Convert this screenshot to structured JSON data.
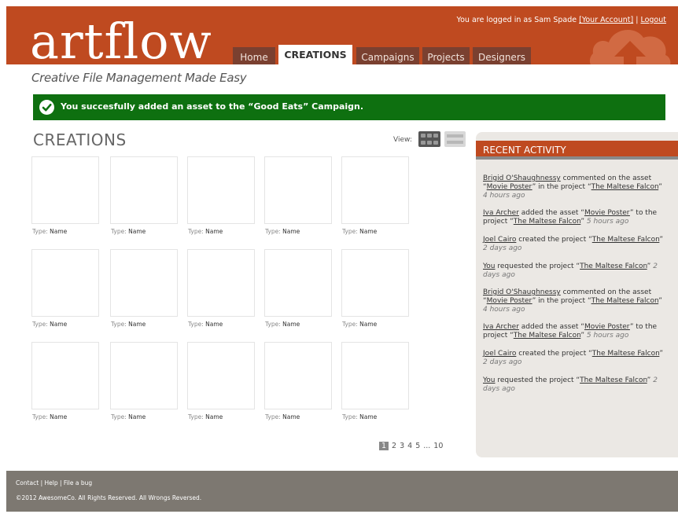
{
  "header": {
    "logo": "artflow",
    "user_prefix": "You are logged in as Sam Spade",
    "account_link": "[Your Account]",
    "separator": "|",
    "logout": "Logout",
    "tagline": "Creative File Management Made Easy"
  },
  "nav": {
    "tabs": [
      {
        "label": "Home"
      },
      {
        "label": "CREATIONS"
      },
      {
        "label": "Campaigns"
      },
      {
        "label": "Projects"
      },
      {
        "label": "Designers"
      }
    ]
  },
  "alert": {
    "message": "You succesfully added an asset to the “Good Eats” Campaign."
  },
  "main": {
    "title": "CREATIONS",
    "view_label": "View:",
    "items": [
      {
        "type_label": "Type:",
        "name": "Name"
      },
      {
        "type_label": "Type:",
        "name": "Name"
      },
      {
        "type_label": "Type:",
        "name": "Name"
      },
      {
        "type_label": "Type:",
        "name": "Name"
      },
      {
        "type_label": "Type:",
        "name": "Name"
      },
      {
        "type_label": "Type:",
        "name": "Name"
      },
      {
        "type_label": "Type:",
        "name": "Name"
      },
      {
        "type_label": "Type:",
        "name": "Name"
      },
      {
        "type_label": "Type:",
        "name": "Name"
      },
      {
        "type_label": "Type:",
        "name": "Name"
      },
      {
        "type_label": "Type:",
        "name": "Name"
      },
      {
        "type_label": "Type:",
        "name": "Name"
      },
      {
        "type_label": "Type:",
        "name": "Name"
      },
      {
        "type_label": "Type:",
        "name": "Name"
      },
      {
        "type_label": "Type:",
        "name": "Name"
      }
    ],
    "pagination": {
      "current": "1",
      "pages": [
        "2",
        "3",
        "4",
        "5"
      ],
      "ellipsis": "...",
      "last": "10"
    }
  },
  "activity": {
    "title": "RECENT ACTIVITY",
    "items": [
      {
        "user": "Brigid O'Shaughnessy",
        "text1": " commented on the asset “",
        "asset": "Movie Poster",
        "text2": "” in the project “",
        "project": "The Maltese Falcon",
        "text3": "”",
        "time": "4 hours ago"
      },
      {
        "user": "Iva Archer",
        "text1": " added the asset “",
        "asset": "Movie Poster",
        "text2": "” to the project “",
        "project": "The Maltese Falcon",
        "text3": "”",
        "time": "5 hours ago"
      },
      {
        "user": "Joel Cairo",
        "text1": " created the project “",
        "project": "The Maltese Falcon",
        "text3": "”",
        "time": "2 days ago"
      },
      {
        "user": "You",
        "text1": " requested the project “",
        "project": "The Maltese Falcon",
        "text3": "”",
        "time": "2 days ago"
      },
      {
        "user": "Brigid O'Shaughnessy",
        "text1": " commented on the asset “",
        "asset": "Movie Poster",
        "text2": "” in the project “",
        "project": "The Maltese Falcon",
        "text3": "”",
        "time": "4 hours ago"
      },
      {
        "user": "Iva Archer",
        "text1": " added the asset “",
        "asset": "Movie Poster",
        "text2": "” to the project “",
        "project": "The Maltese Falcon",
        "text3": "”",
        "time": "5 hours ago"
      },
      {
        "user": "Joel Cairo",
        "text1": " created the project “",
        "project": "The Maltese Falcon",
        "text3": "”",
        "time": "2 days ago"
      },
      {
        "user": "You",
        "text1": " requested the project “",
        "project": "The Maltese Falcon",
        "text3": "”",
        "time": "2 days ago"
      }
    ]
  },
  "footer": {
    "contact": "Contact",
    "help": "Help",
    "bug": "File a bug",
    "sep": "|",
    "copyright": "©2012 AwesomeCo. All Rights Reserved. All Wrongs Reversed."
  }
}
